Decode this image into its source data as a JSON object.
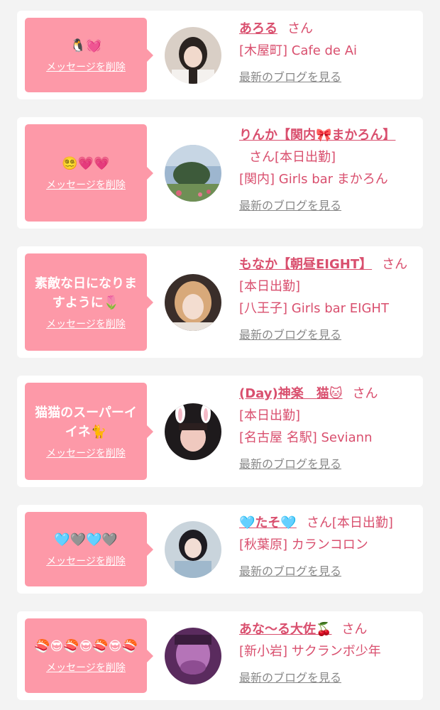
{
  "delete_label": "メッセージを削除",
  "blog_label": "最新のブログを見る",
  "san_label": "さん",
  "cards": [
    {
      "message": "🐧💓",
      "name": "あろる",
      "status": "",
      "shop": "[木屋町] Cafe de Ai"
    },
    {
      "message": "😵‍💫💗💗",
      "name": "りんか【関内🎀まかろん】",
      "status": "[本日出勤]",
      "shop": "[関内] Girls bar まかろん"
    },
    {
      "message": "素敵な日になりますように🌷",
      "name": "もなか【朝昼EIGHT】",
      "status": "[本日出勤]",
      "shop": "[八王子] Girls bar EIGHT"
    },
    {
      "message": "猫猫のスーパーイイネ🐈",
      "name": "(Day)神楽　猫🐱",
      "status": "[本日出勤]",
      "shop": "[名古屋 名駅] Seviann"
    },
    {
      "message": "🩵🩶🩵🩶",
      "name": "🩵たそ🩵",
      "status": "[本日出勤]",
      "shop": "[秋葉原] カランコロン"
    },
    {
      "message": "🍣😎🍣😎🍣😎🍣",
      "name": "あな〜る大佐🍒",
      "status": "",
      "shop": "[新小岩] サクランボ少年"
    }
  ]
}
